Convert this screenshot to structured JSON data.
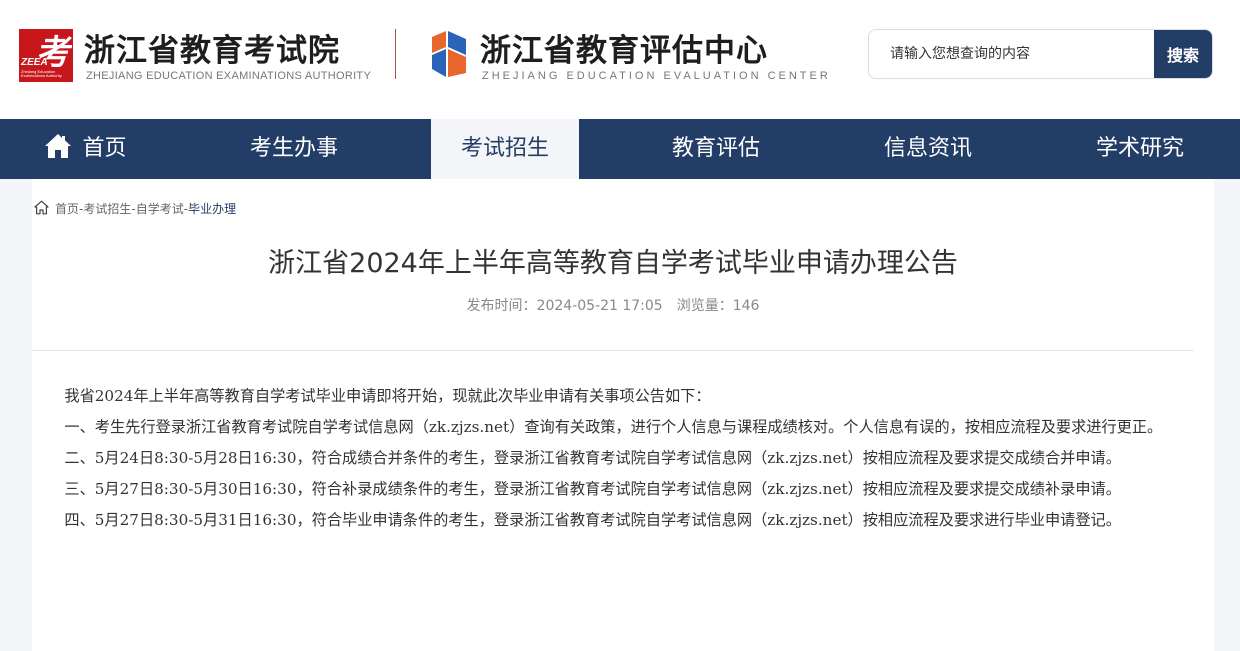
{
  "header": {
    "logo1": {
      "mark_glyph": "考",
      "mark_abbr": "ZEEA",
      "mark_sub": "Zhejiang Education\nExaminations Authority",
      "title": "浙江省教育考试院",
      "en": "ZHEJIANG EDUCATION EXAMINATIONS AUTHORITY"
    },
    "logo2": {
      "title": "浙江省教育评估中心",
      "en": "ZHEJIANG EDUCATION EVALUATION CENTER"
    },
    "search": {
      "placeholder": "请输入您想查询的内容",
      "button": "搜索"
    }
  },
  "nav": {
    "items": [
      {
        "label": "首页",
        "icon": "home-icon"
      },
      {
        "label": "考生办事"
      },
      {
        "label": "考试招生",
        "active": true
      },
      {
        "label": "教育评估"
      },
      {
        "label": "信息资讯"
      },
      {
        "label": "学术研究"
      }
    ]
  },
  "breadcrumb": {
    "items": [
      "首页",
      "考试招生",
      "自学考试",
      "毕业办理"
    ],
    "separator": "-"
  },
  "article": {
    "title": "浙江省2024年上半年高等教育自学考试毕业申请办理公告",
    "publish_label": "发布时间：2024-05-21 17:05",
    "views_label": "浏览量：146",
    "paragraphs": [
      "我省2024年上半年高等教育自学考试毕业申请即将开始，现就此次毕业申请有关事项公告如下：",
      "一、考生先行登录浙江省教育考试院自学考试信息网（zk.zjzs.net）查询有关政策，进行个人信息与课程成绩核对。个人信息有误的，按相应流程及要求进行更正。",
      "二、5月24日8:30-5月28日16:30，符合成绩合并条件的考生，登录浙江省教育考试院自学考试信息网（zk.zjzs.net）按相应流程及要求提交成绩合并申请。",
      "三、5月27日8:30-5月30日16:30，符合补录成绩条件的考生，登录浙江省教育考试院自学考试信息网（zk.zjzs.net）按相应流程及要求提交成绩补录申请。",
      "四、5月27日8:30-5月31日16:30，符合毕业申请条件的考生，登录浙江省教育考试院自学考试信息网（zk.zjzs.net）按相应流程及要求进行毕业申请登记。"
    ]
  },
  "colors": {
    "nav_bg": "#233e66",
    "nav_active_bg": "#f4f5f9",
    "logo1_red": "#c8161d",
    "logo2_blue": "#2a63b8",
    "logo2_orange": "#e8652b",
    "page_bg": "#f4f5f9"
  }
}
